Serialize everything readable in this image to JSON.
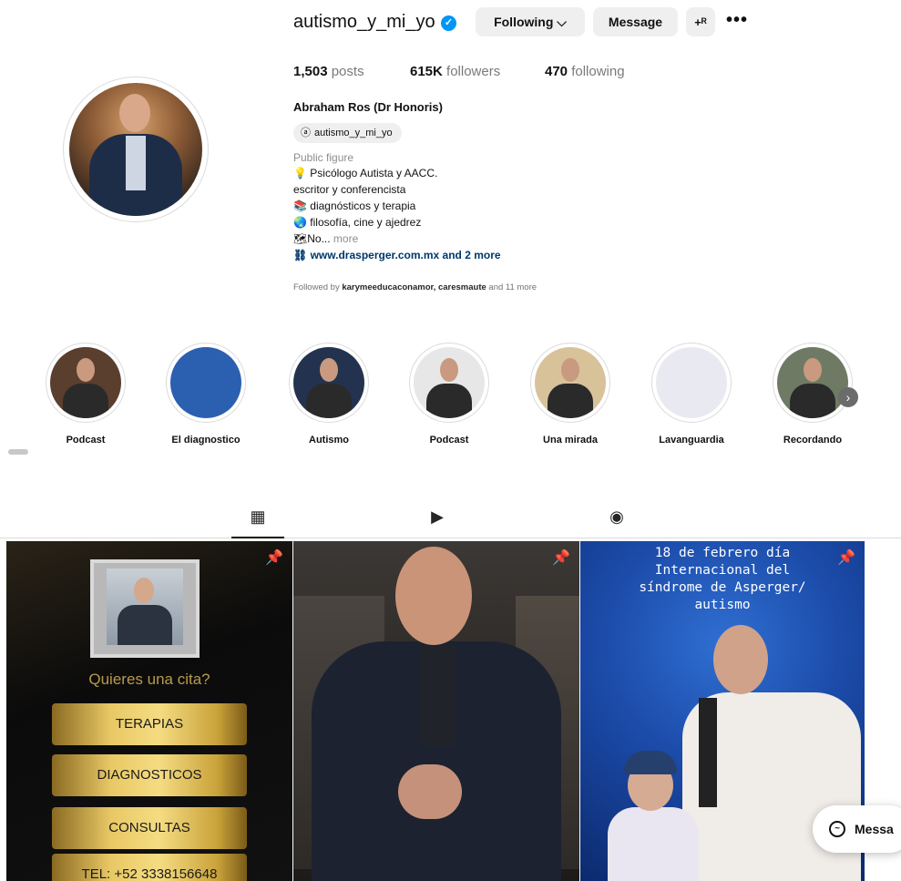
{
  "profile": {
    "username": "autismo_y_mi_yo",
    "following_label": "Following ⌵",
    "message_label": "Message",
    "add_user_icon": "+ᴿ",
    "more_icon": "•••",
    "stats": {
      "posts_count": "1,503",
      "posts_label": " posts",
      "followers_count": "615K",
      "followers_label": " followers",
      "following_count": "470",
      "following_label": " following"
    },
    "full_name": "Abraham Ros (Dr Honoris)",
    "threads_handle": "autismo_y_mi_yo",
    "category": "Public figure",
    "bio": [
      "💡 Psicólogo Autista y AACC.",
      "escritor y conferencista",
      "📚 diagnósticos y terapia",
      "🌏 filosofía, cine y ajedrez",
      "🗺No..."
    ],
    "bio_more": " more",
    "link": "www.drasperger.com.mx and 2 more",
    "followed_by_prefix": "Followed by ",
    "followed_by_names": "karymeeducaconamor, caresmaute",
    "followed_by_suffix": " and 11 more"
  },
  "highlights": [
    {
      "label": "Podcast",
      "bg": "#5a3e2e"
    },
    {
      "label": "El diagnostico",
      "bg": "#2b5fb0"
    },
    {
      "label": "Autismo",
      "bg": "#23324e"
    },
    {
      "label": "Podcast",
      "bg": "#e7e7e7"
    },
    {
      "label": "Una mirada",
      "bg": "#d8c29a"
    },
    {
      "label": "Lavanguardia",
      "bg": "#e9eaf1"
    },
    {
      "label": "Recordando",
      "bg": "#6f7a64"
    }
  ],
  "tabs": {
    "posts_icon": "▦",
    "reels_icon": "▶",
    "tagged_icon": "◉"
  },
  "posts": {
    "p1": {
      "question": "Quieres una cita?",
      "items": [
        "TERAPIAS",
        "DIAGNOSTICOS",
        "CONSULTAS",
        "TEL: +52 3338156648"
      ]
    },
    "p3": {
      "lines": [
        "18 de febrero día",
        "Internacional del",
        "síndrome de Asperger/",
        "autismo"
      ]
    }
  },
  "messages_label": "Messa"
}
